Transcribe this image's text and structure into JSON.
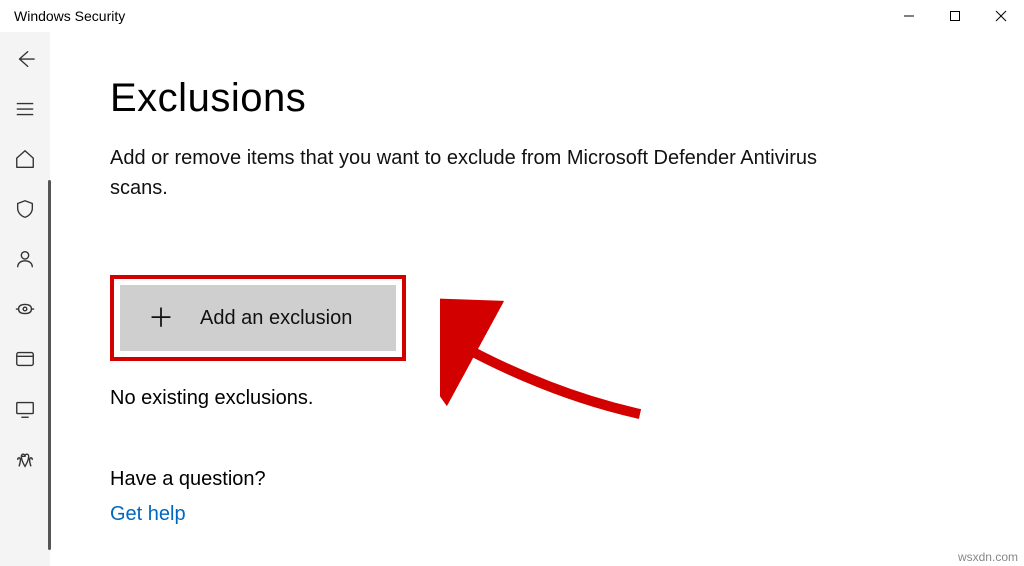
{
  "window": {
    "title": "Windows Security"
  },
  "page": {
    "heading": "Exclusions",
    "description": "Add or remove items that you want to exclude from Microsoft Defender Antivirus scans.",
    "add_button": "Add an exclusion",
    "status": "No existing exclusions.",
    "question": "Have a question?",
    "help_link": "Get help"
  },
  "sidebar_icons": [
    "back",
    "menu",
    "home",
    "shield",
    "account",
    "firewall",
    "app-browser",
    "device-performance",
    "family"
  ],
  "watermark": "wsxdn.com"
}
